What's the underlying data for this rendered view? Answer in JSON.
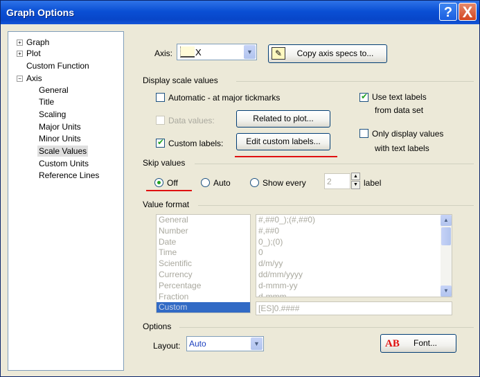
{
  "window": {
    "title": "Graph Options",
    "help_glyph": "?",
    "close_glyph": "X"
  },
  "tree": {
    "items": [
      {
        "label": "Graph",
        "expander": "+"
      },
      {
        "label": "Plot",
        "expander": "+"
      },
      {
        "label": "Custom Function",
        "expander": ""
      },
      {
        "label": "Axis",
        "expander": "−"
      },
      {
        "label": "General"
      },
      {
        "label": "Title"
      },
      {
        "label": "Scaling"
      },
      {
        "label": "Major Units"
      },
      {
        "label": "Minor Units"
      },
      {
        "label": "Scale Values",
        "selected": true
      },
      {
        "label": "Custom Units"
      },
      {
        "label": "Reference Lines"
      }
    ]
  },
  "axis": {
    "label": "Axis:",
    "value": "X",
    "copy_button": "Copy axis specs to..."
  },
  "display_scale": {
    "group_label": "Display scale values",
    "automatic": {
      "label": "Automatic - at major tickmarks",
      "checked": false
    },
    "data_values": {
      "label": "Data values:",
      "checked": false,
      "disabled": true
    },
    "custom_labels": {
      "label": "Custom labels:",
      "checked": true
    },
    "related_button": "Related to plot...",
    "edit_button": "Edit custom labels...",
    "use_text_labels": {
      "line1": "Use text labels",
      "line2": "from data set",
      "checked": true
    },
    "only_display": {
      "line1": "Only display values",
      "line2": "with text labels",
      "checked": false
    }
  },
  "skip_values": {
    "group_label": "Skip values",
    "off": "Off",
    "auto": "Auto",
    "show_every": "Show every",
    "count": "2",
    "suffix": "label",
    "selected": "Off"
  },
  "value_format": {
    "group_label": "Value format",
    "categories": [
      "General",
      "Number",
      "Date",
      "Time",
      "Scientific",
      "Currency",
      "Percentage",
      "Fraction",
      "Custom"
    ],
    "selected_category": "Custom",
    "formats": [
      "#,##0_);(#,##0)",
      "#,##0",
      "0_);(0)",
      "0",
      "d/m/yy",
      "dd/mm/yyyy",
      "d-mmm-yy",
      "d-mmm"
    ],
    "format_field": "[ES]0.####"
  },
  "options": {
    "group_label": "Options",
    "layout_label": "Layout:",
    "layout_value": "Auto",
    "font_icon": "AB",
    "font_button": "Font..."
  },
  "colors": {
    "accent_red": "#e01010",
    "check_green": "#21a121",
    "title_blue": "#0a4fd4"
  }
}
